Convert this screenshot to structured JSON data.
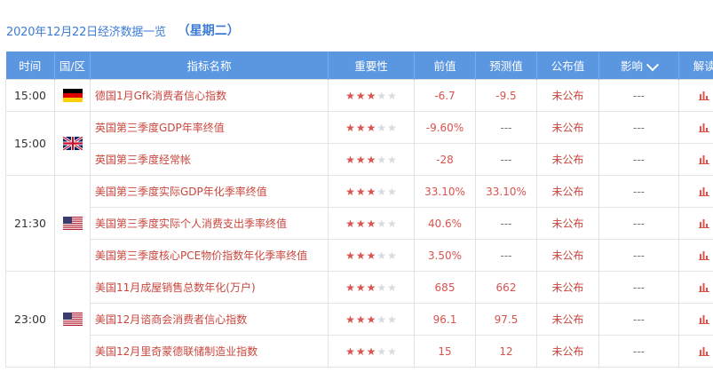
{
  "header": {
    "date": "2020年12月22日经济数据一览",
    "weekday": "（星期二）"
  },
  "columns": {
    "time": "时间",
    "region": "国/区",
    "indicator": "指标名称",
    "importance": "重要性",
    "previous": "前值",
    "forecast": "预测值",
    "actual": "公布值",
    "influence": "影响",
    "analysis": "解读"
  },
  "groups": [
    {
      "time": "15:00",
      "country": "germany",
      "rows": [
        {
          "name": "德国1月Gfk消费者信心指数",
          "stars": 3,
          "previous": "-6.7",
          "forecast": "-9.5",
          "actual": "未公布",
          "influence": "---"
        }
      ]
    },
    {
      "time": "15:00",
      "country": "uk",
      "rows": [
        {
          "name": "英国第三季度GDP年率终值",
          "stars": 3,
          "previous": "-9.60%",
          "forecast": "---",
          "actual": "未公布",
          "influence": "---"
        },
        {
          "name": "英国第三季度经常帐",
          "stars": 3,
          "previous": "-28",
          "forecast": "---",
          "actual": "未公布",
          "influence": "---"
        }
      ]
    },
    {
      "time": "21:30",
      "country": "us",
      "rows": [
        {
          "name": "美国第三季度实际GDP年化季率终值",
          "stars": 3,
          "previous": "33.10%",
          "forecast": "33.10%",
          "actual": "未公布",
          "influence": "---"
        },
        {
          "name": "美国第三季度实际个人消费支出季率终值",
          "stars": 3,
          "previous": "40.6%",
          "forecast": "---",
          "actual": "未公布",
          "influence": "---"
        },
        {
          "name": "美国第三季度核心PCE物价指数年化季率终值",
          "stars": 3,
          "previous": "3.50%",
          "forecast": "---",
          "actual": "未公布",
          "influence": "---"
        }
      ]
    },
    {
      "time": "23:00",
      "country": "us",
      "rows": [
        {
          "name": "美国11月成屋销售总数年化(万户)",
          "stars": 3,
          "previous": "685",
          "forecast": "662",
          "actual": "未公布",
          "influence": "---"
        },
        {
          "name": "美国12月谘商会消费者信心指数",
          "stars": 3,
          "previous": "96.1",
          "forecast": "97.5",
          "actual": "未公布",
          "influence": "---"
        },
        {
          "name": "美国12月里奇蒙德联储制造业指数",
          "stars": 3,
          "previous": "15",
          "forecast": "12",
          "actual": "未公布",
          "influence": "---"
        }
      ]
    }
  ],
  "colors": {
    "header_bg": "#5b97e1",
    "accent_blue": "#3d7bd6",
    "accent_red": "#d9534f"
  }
}
